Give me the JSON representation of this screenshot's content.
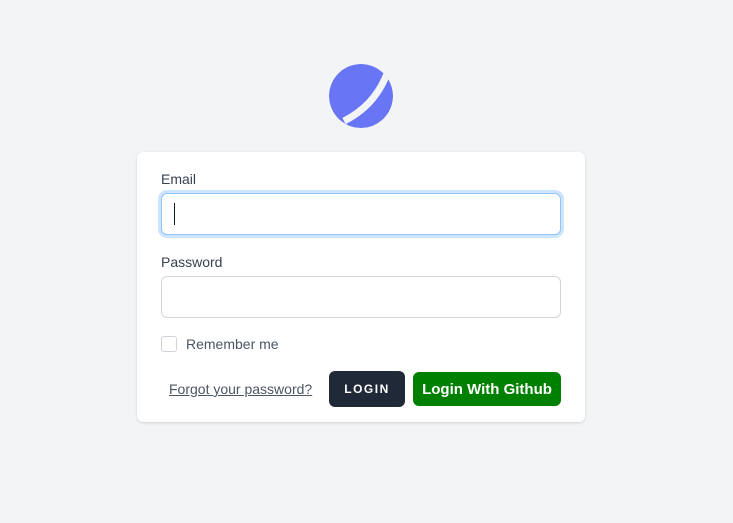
{
  "logo": {
    "icon": "moon-logo-icon",
    "color": "#6875f5"
  },
  "form": {
    "email_label": "Email",
    "email_value": "",
    "password_label": "Password",
    "password_value": "",
    "remember_label": "Remember me",
    "remember_checked": false,
    "forgot_link": "Forgot your password?",
    "login_button": "LOGIN",
    "github_button": "Login With Github"
  },
  "colors": {
    "background": "#f3f4f6",
    "login_button": "#1f2937",
    "github_button": "#008000",
    "focus_ring": "#93c5fd"
  }
}
